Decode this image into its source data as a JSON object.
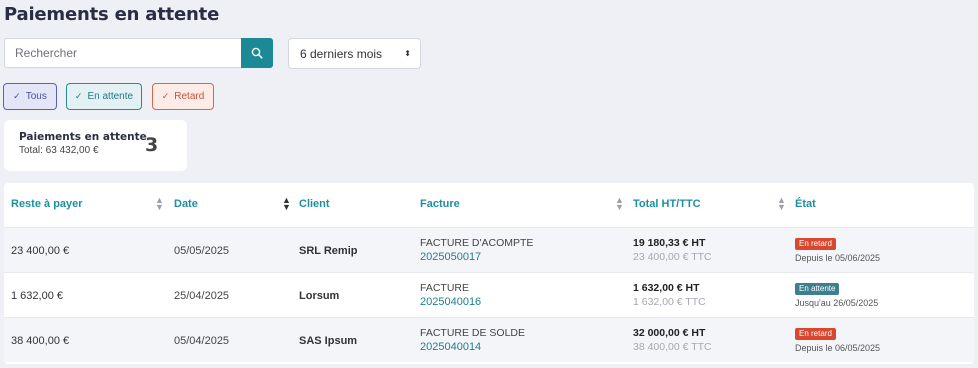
{
  "page": {
    "title": "Paiements en attente"
  },
  "search": {
    "placeholder": "Rechercher",
    "icon": "search-icon"
  },
  "period": {
    "selected": "6 derniers mois"
  },
  "filters": [
    {
      "label": "Tous",
      "icon": "check-icon"
    },
    {
      "label": "En attente",
      "icon": "check-icon"
    },
    {
      "label": "Retard",
      "icon": "check-icon"
    }
  ],
  "summary": {
    "title": "Paiements en attente",
    "total": "Total: 63 432,00 €",
    "count": "3"
  },
  "table": {
    "columns": [
      "Reste à payer",
      "Date",
      "Client",
      "Facture",
      "Total HT/TTC",
      "État"
    ],
    "rows": [
      {
        "reste": "23 400,00 €",
        "date": "05/05/2025",
        "client": "SRL Remip",
        "facture_type": "FACTURE D'ACOMPTE",
        "facture_num": "2025050017",
        "total_ht": "19 180,33 € HT",
        "total_ttc": "23 400,00 € TTC",
        "etat": "En retard",
        "etat_detail": "Depuis le 05/06/2025"
      },
      {
        "reste": "1 632,00 €",
        "date": "25/04/2025",
        "client": "Lorsum",
        "facture_type": "FACTURE",
        "facture_num": "2025040016",
        "total_ht": "1 632,00 € HT",
        "total_ttc": "1 632,00 € TTC",
        "etat": "En attente",
        "etat_detail": "Jusqu'au 26/05/2025"
      },
      {
        "reste": "38 400,00 €",
        "date": "05/04/2025",
        "client": "SAS Ipsum",
        "facture_type": "FACTURE DE SOLDE",
        "facture_num": "2025040014",
        "total_ht": "32 000,00 € HT",
        "total_ttc": "38 400,00 € TTC",
        "etat": "En retard",
        "etat_detail": "Depuis le 06/05/2025"
      }
    ]
  },
  "colors": {
    "accent": "#1b8a96",
    "late": "#d9472f",
    "pending": "#3d7f8e",
    "header_text": "#1e8fa0"
  }
}
